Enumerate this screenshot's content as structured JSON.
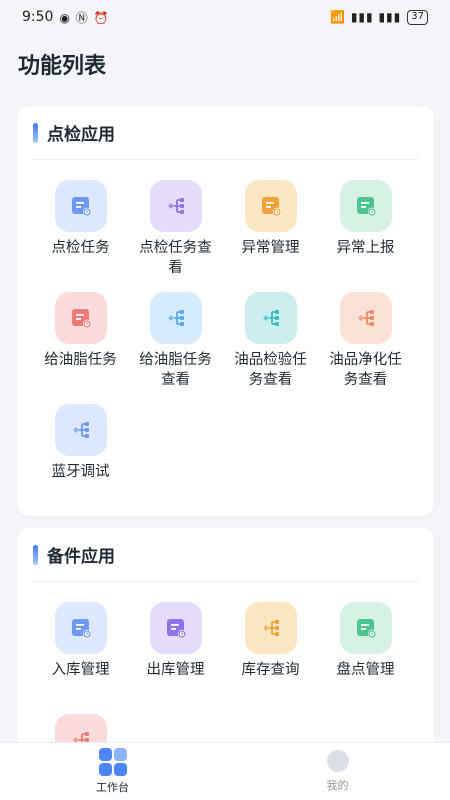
{
  "status": {
    "time": "9:50",
    "battery": "37"
  },
  "page_title": "功能列表",
  "sections": [
    {
      "title": "点检应用",
      "apps": [
        {
          "label": "点检任务",
          "icon": "doc-clock-icon",
          "color": "#6e98f2",
          "bg": "#dde8fd"
        },
        {
          "label": "点检任务查看",
          "icon": "flow-icon",
          "color": "#8d74e6",
          "bg": "#e5dcfb"
        },
        {
          "label": "异常管理",
          "icon": "doc-clock-icon",
          "color": "#f0a23b",
          "bg": "#fbe7c3"
        },
        {
          "label": "异常上报",
          "icon": "doc-clock-icon",
          "color": "#4cc591",
          "bg": "#d8f1e5"
        },
        {
          "label": "给油脂任务",
          "icon": "doc-clock-icon",
          "color": "#ef7a7a",
          "bg": "#fbdcdc"
        },
        {
          "label": "给油脂任务查看",
          "icon": "flow-icon",
          "color": "#58a9ef",
          "bg": "#d6ecfc"
        },
        {
          "label": "油品检验任务查看",
          "icon": "flow-icon",
          "color": "#3cbcc0",
          "bg": "#cdeeee"
        },
        {
          "label": "油品净化任务查看",
          "icon": "flow-icon",
          "color": "#f08a62",
          "bg": "#fce1d6"
        },
        {
          "label": "蓝牙调试",
          "icon": "flow-icon",
          "color": "#6e98f2",
          "bg": "#dde8fd"
        }
      ]
    },
    {
      "title": "备件应用",
      "apps": [
        {
          "label": "入库管理",
          "icon": "doc-clock-icon",
          "color": "#6e98f2",
          "bg": "#dde8fd"
        },
        {
          "label": "出库管理",
          "icon": "doc-clock-icon",
          "color": "#8d74e6",
          "bg": "#e5dcfb"
        },
        {
          "label": "库存查询",
          "icon": "flow-icon",
          "color": "#f0a23b",
          "bg": "#fbe7c3"
        },
        {
          "label": "盘点管理",
          "icon": "doc-clock-icon",
          "color": "#4cc591",
          "bg": "#d8f1e5"
        },
        {
          "label": "",
          "icon": "flow-icon",
          "color": "#ef7a7a",
          "bg": "#fbdcdc"
        }
      ]
    }
  ],
  "tabbar": {
    "workbench": "工作台",
    "mine": "我的"
  }
}
